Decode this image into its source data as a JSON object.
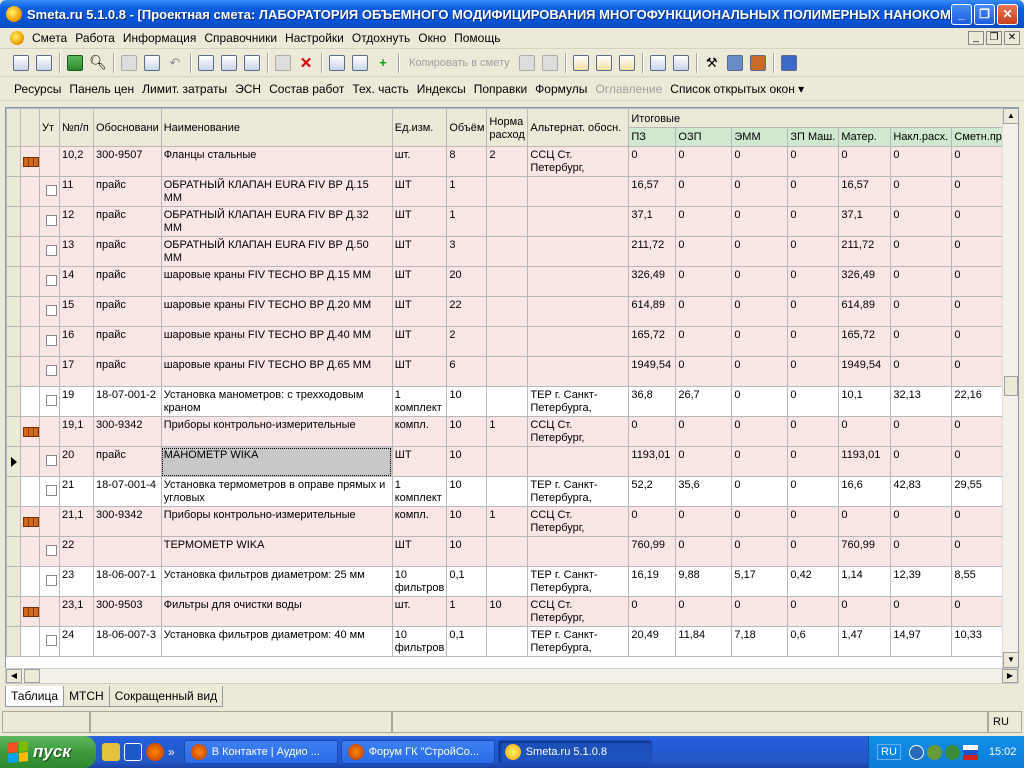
{
  "window": {
    "title": "Smeta.ru  5.1.0.8   - [Проектная смета: ЛАБОРАТОРИЯ ОБЪЕМНОГО МОДИФИЦИРОВАНИЯ МНОГОФУНКЦИОНАЛЬНЫХ ПОЛИМЕРНЫХ НАНОКОМП..."
  },
  "menu": [
    "Смета",
    "Работа",
    "Информация",
    "Справочники",
    "Настройки",
    "Отдохнуть",
    "Окно",
    "Помощь"
  ],
  "toolbar": {
    "copy_label": "Копировать в смету"
  },
  "toolbar2": [
    "Ресурсы",
    "Панель цен",
    "Лимит. затраты",
    "ЭСН",
    "Состав работ",
    "Тех. часть",
    "Индексы",
    "Поправки",
    "Формулы",
    "Оглавление",
    "Список открытых окон ▾"
  ],
  "toolbar2_disabled": "Оглавление",
  "grid": {
    "headers": {
      "ut": "Ут",
      "num": "№п/п",
      "basis": "Обосновани",
      "name": "Наименование",
      "unit": "Ед.изм.",
      "volume": "Объём",
      "norm": "Норма расход",
      "alt": "Альтернат. обосн.",
      "totals": "Итоговые"
    },
    "subheaders": [
      "ПЗ",
      "ОЗП",
      "ЭММ",
      "ЗП Маш.",
      "Матер.",
      "Накл.расх.",
      "Сметн.приб"
    ],
    "rows": [
      {
        "type": "res",
        "num": "10,2",
        "basis": "300-9507",
        "name": "Фланцы стальные",
        "unit": "шт.",
        "volume": "8",
        "norm": "2",
        "alt": "ССЦ Ст. Петербург,",
        "v": [
          "0",
          "0",
          "0",
          "0",
          "0",
          "0",
          "0"
        ]
      },
      {
        "type": "item",
        "num": "11",
        "basis": "прайс",
        "name": "ОБРАТНЫЙ КЛАПАН EURA FIV ВР Д.15 ММ",
        "unit": "ШТ",
        "volume": "1",
        "norm": "",
        "alt": "",
        "v": [
          "16,57",
          "0",
          "0",
          "0",
          "16,57",
          "0",
          "0"
        ]
      },
      {
        "type": "item",
        "num": "12",
        "basis": "прайс",
        "name": "ОБРАТНЫЙ КЛАПАН EURA FIV ВР Д.32 ММ",
        "unit": "ШТ",
        "volume": "1",
        "norm": "",
        "alt": "",
        "v": [
          "37,1",
          "0",
          "0",
          "0",
          "37,1",
          "0",
          "0"
        ]
      },
      {
        "type": "item",
        "num": "13",
        "basis": "прайс",
        "name": "ОБРАТНЫЙ КЛАПАН EURA FIV ВР Д.50 ММ",
        "unit": "ШТ",
        "volume": "3",
        "norm": "",
        "alt": "",
        "v": [
          "211,72",
          "0",
          "0",
          "0",
          "211,72",
          "0",
          "0"
        ]
      },
      {
        "type": "item",
        "num": "14",
        "basis": "прайс",
        "name": "шаровые краны FIV TECHO BP Д.15 ММ",
        "unit": "ШТ",
        "volume": "20",
        "norm": "",
        "alt": "",
        "v": [
          "326,49",
          "0",
          "0",
          "0",
          "326,49",
          "0",
          "0"
        ]
      },
      {
        "type": "item",
        "num": "15",
        "basis": "прайс",
        "name": "шаровые краны FIV TECHO BP Д.20 ММ",
        "unit": "ШТ",
        "volume": "22",
        "norm": "",
        "alt": "",
        "v": [
          "614,89",
          "0",
          "0",
          "0",
          "614,89",
          "0",
          "0"
        ]
      },
      {
        "type": "item",
        "num": "16",
        "basis": "прайс",
        "name": "шаровые краны FIV TECHO BP Д.40 ММ",
        "unit": "ШТ",
        "volume": "2",
        "norm": "",
        "alt": "",
        "v": [
          "165,72",
          "0",
          "0",
          "0",
          "165,72",
          "0",
          "0"
        ]
      },
      {
        "type": "item",
        "num": "17",
        "basis": "прайс",
        "name": "шаровые краны FIV TECHO BP Д.65 ММ",
        "unit": "ШТ",
        "volume": "6",
        "norm": "",
        "alt": "",
        "v": [
          "1949,54",
          "0",
          "0",
          "0",
          "1949,54",
          "0",
          "0"
        ]
      },
      {
        "type": "work",
        "num": "19",
        "basis": "18-07-001-2",
        "name": "Установка манометров: с трехходовым краном",
        "unit": "1 комплект",
        "volume": "10",
        "norm": "",
        "alt": "ТЕР г. Санкт-Петербурга,",
        "v": [
          "36,8",
          "26,7",
          "0",
          "0",
          "10,1",
          "32,13",
          "22,16"
        ]
      },
      {
        "type": "res",
        "num": "19,1",
        "basis": "300-9342",
        "name": "Приборы контрольно-измерительные",
        "unit": "компл.",
        "volume": "10",
        "norm": "1",
        "alt": "ССЦ Ст. Петербург,",
        "v": [
          "0",
          "0",
          "0",
          "0",
          "0",
          "0",
          "0"
        ]
      },
      {
        "type": "item",
        "num": "20",
        "basis": "прайс",
        "name": "МАНОМЕТР WIKA",
        "unit": "ШТ",
        "volume": "10",
        "norm": "",
        "alt": "",
        "v": [
          "1193,01",
          "0",
          "0",
          "0",
          "1193,01",
          "0",
          "0"
        ],
        "current": true
      },
      {
        "type": "work",
        "num": "21",
        "basis": "18-07-001-4",
        "name": "Установка термометров в оправе прямых и угловых",
        "unit": "1 комплект",
        "volume": "10",
        "norm": "",
        "alt": "ТЕР г. Санкт-Петербурга,",
        "v": [
          "52,2",
          "35,6",
          "0",
          "0",
          "16,6",
          "42,83",
          "29,55"
        ]
      },
      {
        "type": "res",
        "num": "21,1",
        "basis": "300-9342",
        "name": "Приборы контрольно-измерительные",
        "unit": "компл.",
        "volume": "10",
        "norm": "1",
        "alt": "ССЦ Ст. Петербург,",
        "v": [
          "0",
          "0",
          "0",
          "0",
          "0",
          "0",
          "0"
        ]
      },
      {
        "type": "item",
        "num": "22",
        "basis": "",
        "name": "ТЕРМОМЕТР WIKA",
        "unit": "ШТ",
        "volume": "10",
        "norm": "",
        "alt": "",
        "v": [
          "760,99",
          "0",
          "0",
          "0",
          "760,99",
          "0",
          "0"
        ]
      },
      {
        "type": "work",
        "num": "23",
        "basis": "18-06-007-1",
        "name": "Установка фильтров диаметром: 25 мм",
        "unit": "10 фильтров",
        "volume": "0,1",
        "norm": "",
        "alt": "ТЕР г. Санкт-Петербурга,",
        "v": [
          "16,19",
          "9,88",
          "5,17",
          "0,42",
          "1,14",
          "12,39",
          "8,55"
        ]
      },
      {
        "type": "res",
        "num": "23,1",
        "basis": "300-9503",
        "name": "Фильтры для очистки воды",
        "unit": "шт.",
        "volume": "1",
        "norm": "10",
        "alt": "ССЦ Ст. Петербург,",
        "v": [
          "0",
          "0",
          "0",
          "0",
          "0",
          "0",
          "0"
        ]
      },
      {
        "type": "work",
        "num": "24",
        "basis": "18-06-007-3",
        "name": "Установка фильтров диаметром: 40 мм",
        "unit": "10 фильтров",
        "volume": "0,1",
        "norm": "",
        "alt": "ТЕР г. Санкт-Петербурга,",
        "v": [
          "20,49",
          "11,84",
          "7,18",
          "0,6",
          "1,47",
          "14,97",
          "10,33"
        ]
      }
    ]
  },
  "tabs": [
    "Таблица",
    "МТСН",
    "Сокращенный вид"
  ],
  "status": {
    "lang": "RU"
  },
  "taskbar": {
    "start": "пуск",
    "tasks": [
      "В Контакте | Аудио ...",
      "Форум ГК \"СтройСо...",
      "Smeta.ru  5.1.0.8"
    ],
    "lang": "RU",
    "time": "15:02"
  }
}
